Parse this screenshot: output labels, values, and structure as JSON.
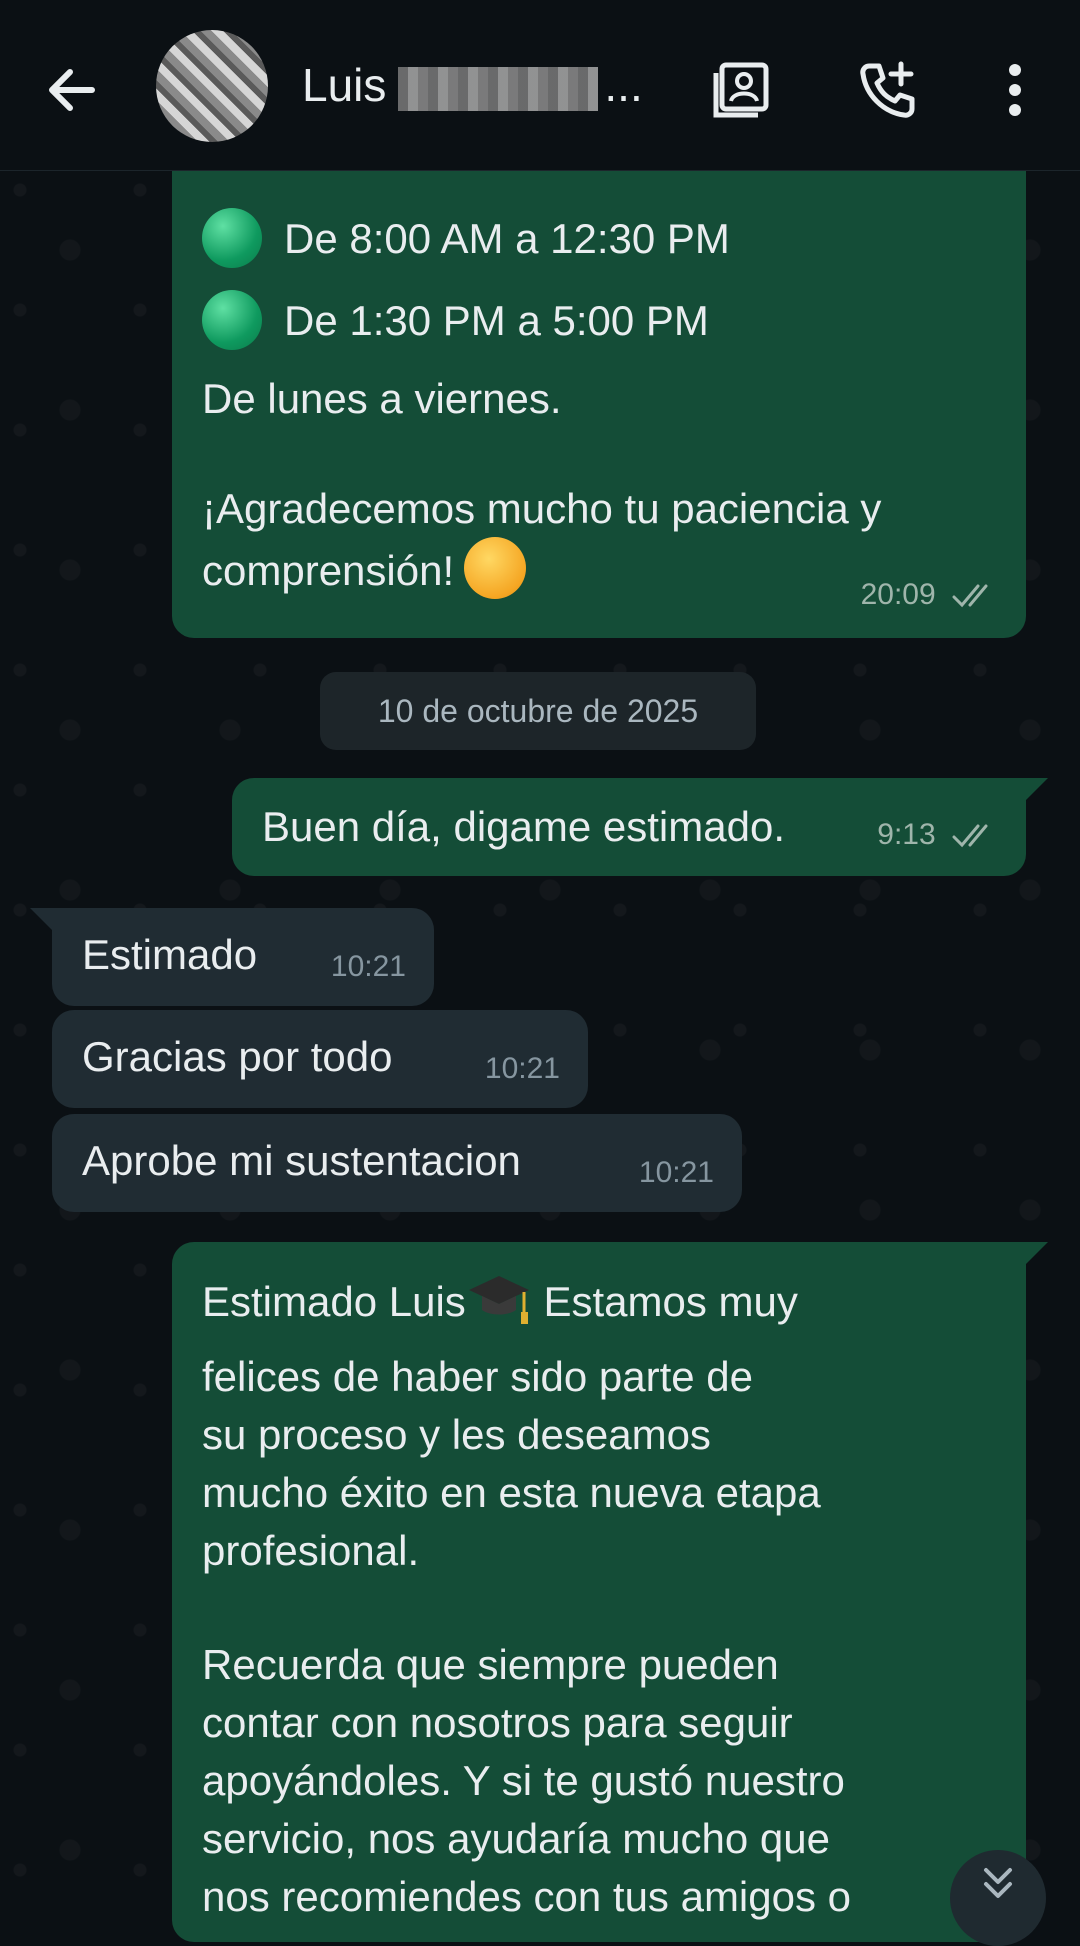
{
  "header": {
    "contact_name": "Luis",
    "contact_name_suffix": "..."
  },
  "icons": {
    "back": "arrow-left-icon",
    "contacts": "contact-card-icon",
    "call": "add-call-icon",
    "menu": "more-vertical-icon",
    "scroll_down": "double-chevron-down-icon"
  },
  "messages": {
    "m1": {
      "line_1": "De 8:00 AM a 12:30 PM",
      "line_2": "De 1:30 PM a 5:00 PM",
      "line_3": "De lunes a viernes.",
      "line_4": "¡Agradecemos mucho tu paciencia y",
      "line_5": "comprensión!",
      "time": "20:09"
    },
    "date_separator": "10 de octubre de 2025",
    "m2": {
      "text": "Buen día, digame estimado.",
      "time": "9:13"
    },
    "m3": {
      "text": "Estimado",
      "time": "10:21"
    },
    "m4": {
      "text": "Gracias por todo",
      "time": "10:21"
    },
    "m5": {
      "text": "Aprobe mi sustentacion",
      "time": "10:21"
    },
    "m6": {
      "line_1a": "Estimado Luis",
      "line_1b": "Estamos muy",
      "line_2": "felices de haber sido parte de",
      "line_3": "su proceso y les deseamos",
      "line_4": "mucho éxito en esta nueva etapa",
      "line_5": "profesional.",
      "line_6": "Recuerda que siempre pueden",
      "line_7": "contar con nosotros para seguir",
      "line_8": "apoyándoles. Y si te gustó nuestro",
      "line_9": "servicio, nos ayudaría mucho que",
      "line_10": "nos recomiendes con tus amigos o"
    }
  },
  "colors": {
    "outgoing_bubble": "#144d37",
    "incoming_bubble": "#202c33",
    "background": "#0b1014"
  }
}
